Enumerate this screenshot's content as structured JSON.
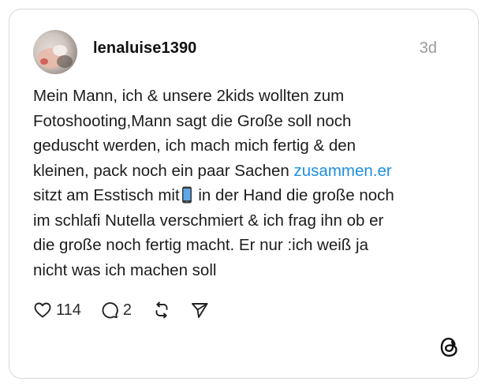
{
  "post": {
    "username": "lenaluise1390",
    "time": "3d",
    "lines": [
      "Mein Mann, ich & unsere 2kids wollten zum",
      "Fotoshooting,Mann sagt die Große soll noch",
      "geduscht werden, ich mach mich fertig & den"
    ],
    "line4_text": "kleinen, pack noch ein paar Sachen ",
    "line4_link": "zusammen.er",
    "line5_before": "sitzt am Esstisch mit",
    "line5_after": " in der Hand die große noch",
    "lines_rest": [
      "im schlafi Nutella verschmiert & ich frag ihn ob er",
      "die große noch fertig macht. Er nur :ich weiß ja",
      "nicht was ich machen soll"
    ]
  },
  "actions": {
    "likes": "114",
    "comments": "2"
  },
  "icons": {
    "like": "heart-icon",
    "comment": "comment-icon",
    "repost": "repost-icon",
    "share": "send-icon",
    "emoji": "mobile-phone-emoji-icon",
    "brand": "threads-logo-icon"
  },
  "colors": {
    "link": "#1d8fe0",
    "muted": "#9a9a9a",
    "border": "#d9d9d9"
  }
}
